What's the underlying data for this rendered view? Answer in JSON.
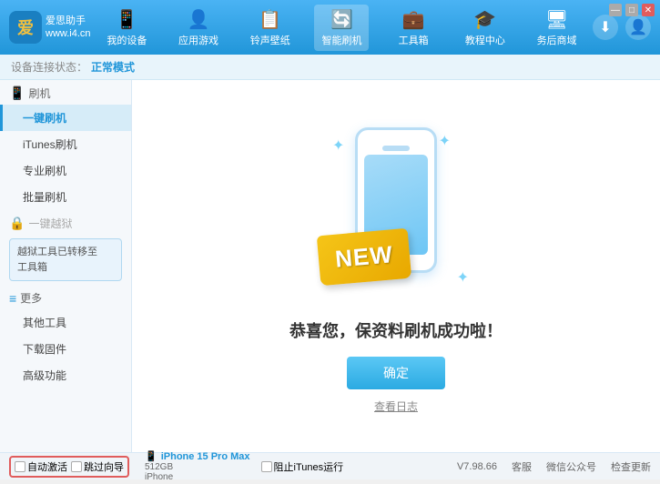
{
  "app": {
    "title": "爱思助手",
    "subtitle": "www.i4.cn"
  },
  "window_controls": {
    "minimize": "—",
    "maximize": "□",
    "close": "✕"
  },
  "nav": {
    "items": [
      {
        "id": "my-device",
        "icon": "📱",
        "label": "我的设备"
      },
      {
        "id": "apps-games",
        "icon": "👤",
        "label": "应用游戏"
      },
      {
        "id": "ringtones",
        "icon": "📋",
        "label": "铃声壁纸"
      },
      {
        "id": "smart-flash",
        "icon": "🔄",
        "label": "智能刷机",
        "active": true
      },
      {
        "id": "toolbox",
        "icon": "💼",
        "label": "工具箱"
      },
      {
        "id": "tutorial",
        "icon": "🎓",
        "label": "教程中心"
      },
      {
        "id": "business",
        "icon": "🖥",
        "label": "务后商域"
      }
    ],
    "download_icon": "⬇",
    "user_icon": "👤"
  },
  "status_bar": {
    "label": "设备连接状态：",
    "value": "正常模式"
  },
  "sidebar": {
    "sections": [
      {
        "id": "flash",
        "icon": "📱",
        "label": "刷机",
        "items": [
          {
            "id": "one-click-flash",
            "label": "一键刷机",
            "active": true
          },
          {
            "id": "itunes-flash",
            "label": "iTunes刷机"
          },
          {
            "id": "pro-flash",
            "label": "专业刷机"
          },
          {
            "id": "batch-flash",
            "label": "批量刷机"
          }
        ]
      },
      {
        "id": "jailbreak",
        "icon": "🔒",
        "label": "一键越狱",
        "disabled": true,
        "notice": "越狱工具已转移至\n工具箱"
      },
      {
        "id": "more",
        "icon": "≡",
        "label": "更多",
        "items": [
          {
            "id": "other-tools",
            "label": "其他工具"
          },
          {
            "id": "download-firmware",
            "label": "下载固件"
          },
          {
            "id": "advanced",
            "label": "高级功能"
          }
        ]
      }
    ]
  },
  "content": {
    "success_title": "恭喜您，保资料刷机成功啦！",
    "confirm_button": "确定",
    "log_link": "查看日志",
    "new_badge": "NEW"
  },
  "bottom": {
    "auto_activate": "自动激活",
    "auto_guide": "跳过向导",
    "device_icon": "📱",
    "device_name": "iPhone 15 Pro Max",
    "device_storage": "512GB",
    "device_type": "iPhone",
    "stop_itunes_checkbox": false,
    "stop_itunes_label": "阻止iTunes运行",
    "version": "V7.98.66",
    "links": [
      "客服",
      "微信公众号",
      "检查更新"
    ]
  }
}
